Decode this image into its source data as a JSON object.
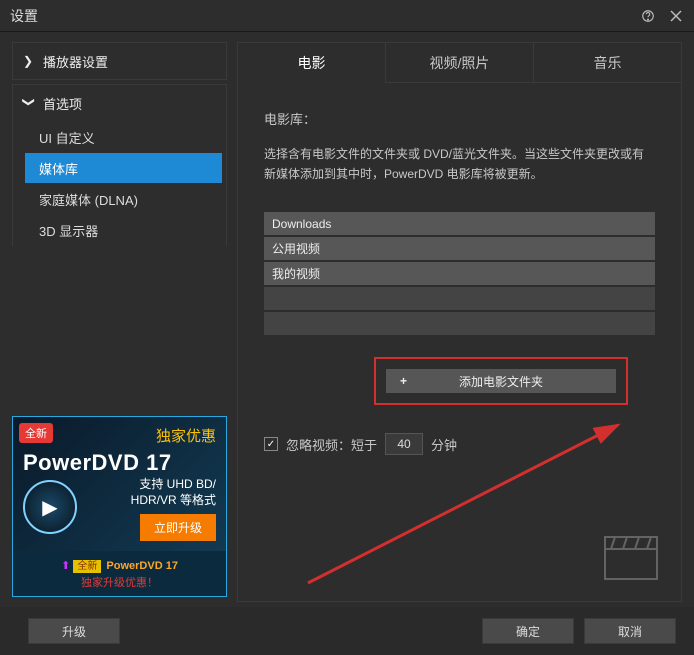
{
  "title": "设置",
  "sidebar": {
    "section1": {
      "label": "播放器设置"
    },
    "section2": {
      "label": "首选项",
      "items": [
        {
          "label": "UI 自定义"
        },
        {
          "label": "媒体库"
        },
        {
          "label": "家庭媒体 (DLNA)"
        },
        {
          "label": "3D 显示器"
        }
      ]
    }
  },
  "promo": {
    "badge": "全新",
    "title": "独家优惠",
    "brand": "PowerDVD 17",
    "sub1": "支持 UHD BD/",
    "sub2": "HDR/VR 等格式",
    "button": "立即升级",
    "bottom_badge": "全新",
    "bottom_brand": "PowerDVD 17",
    "bottom_line": "独家升级优惠！"
  },
  "tabs": [
    {
      "label": "电影"
    },
    {
      "label": "视频/照片"
    },
    {
      "label": "音乐"
    }
  ],
  "panel": {
    "heading": "电影库：",
    "desc": "选择含有电影文件的文件夹或 DVD/蓝光文件夹。当这些文件夹更改或有新媒体添加到其中时，PowerDVD 电影库将被更新。",
    "folders": [
      "Downloads",
      "公用视频",
      "我的视频"
    ],
    "add_button": "添加电影文件夹",
    "ignore_label_prefix": "忽略视频：短于",
    "ignore_value": "40",
    "ignore_unit": "分钟"
  },
  "footer": {
    "upgrade": "升级",
    "ok": "确定",
    "cancel": "取消"
  }
}
